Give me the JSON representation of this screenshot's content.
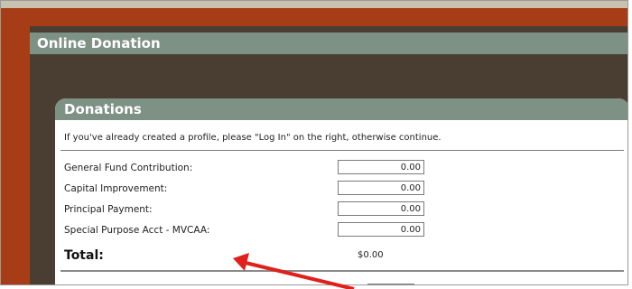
{
  "header": {
    "title": "Online Donation"
  },
  "donations": {
    "title": "Donations",
    "intro": "If you've already created a profile, please \"Log In\" on the right, otherwise continue.",
    "rows": [
      {
        "label": "General Fund Contribution:",
        "value": "0.00"
      },
      {
        "label": "Capital Improvement:",
        "value": "0.00"
      },
      {
        "label": "Principal Payment:",
        "value": "0.00"
      },
      {
        "label": "Special Purpose Acct - MVCAA:",
        "value": "0.00"
      }
    ],
    "total_label": "Total:",
    "total_value": "$0.00"
  },
  "colors": {
    "outer": "#a63d16",
    "inner": "#4a3e33",
    "header": "#7d9184",
    "arrow": "#e0201a"
  },
  "annotation_icon": "red-arrow-icon"
}
